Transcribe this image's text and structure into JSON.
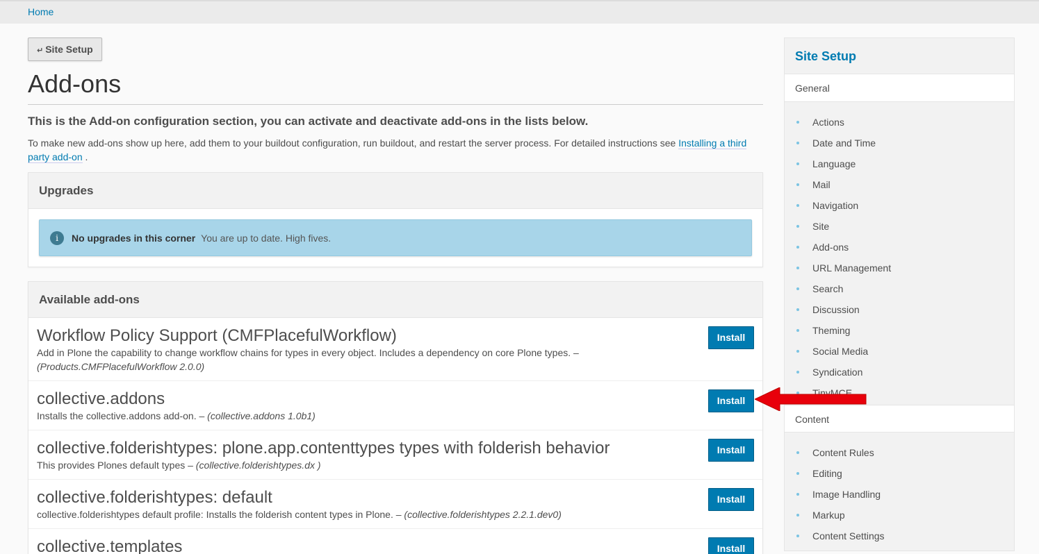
{
  "breadcrumb": {
    "home": "Home"
  },
  "back_button": {
    "arrow": "↵",
    "label": "Site Setup"
  },
  "page_title": "Add-ons",
  "lead": "This is the Add-on configuration section, you can activate and deactivate add-ons in the lists below.",
  "description": {
    "text": "To make new add-ons show up here, add them to your buildout configuration, run buildout, and restart the server process. For detailed instructions see ",
    "link": "Installing a third party add-on",
    "suffix": " ."
  },
  "upgrades": {
    "heading": "Upgrades",
    "info_icon": "i",
    "info_title": "No upgrades in this corner",
    "info_text": "You are up to date. High fives."
  },
  "available": {
    "heading": "Available add-ons",
    "install_label": "Install",
    "items": [
      {
        "title": "Workflow Policy Support (CMFPlacefulWorkflow)",
        "desc": "Add in Plone the capability to change workflow chains for types in every object. Includes a dependency on core Plone types. –",
        "product": "(Products.CMFPlacefulWorkflow 2.0.0)"
      },
      {
        "title": "collective.addons",
        "desc": "Installs the collective.addons add-on. –",
        "product": "(collective.addons 1.0b1)"
      },
      {
        "title": "collective.folderishtypes: plone.app.contenttypes types with folderish behavior",
        "desc": "This provides Plones default types –",
        "product": "(collective.folderishtypes.dx )"
      },
      {
        "title": "collective.folderishtypes: default",
        "desc": "collective.folderishtypes default profile: Installs the folderish content types in Plone. –",
        "product": "(collective.folderishtypes 2.2.1.dev0)"
      },
      {
        "title": "collective.templates",
        "desc": "",
        "product": ""
      }
    ]
  },
  "sidebar": {
    "title": "Site Setup",
    "general_heading": "General",
    "general_items": [
      "Actions",
      "Date and Time",
      "Language",
      "Mail",
      "Navigation",
      "Site",
      "Add-ons",
      "URL Management",
      "Search",
      "Discussion",
      "Theming",
      "Social Media",
      "Syndication",
      "TinyMCE"
    ],
    "content_heading": "Content",
    "content_items": [
      "Content Rules",
      "Editing",
      "Image Handling",
      "Markup",
      "Content Settings"
    ]
  },
  "colors": {
    "accent": "#007bb1",
    "info_bg": "#a8d5e9",
    "arrow": "#e8000b"
  }
}
